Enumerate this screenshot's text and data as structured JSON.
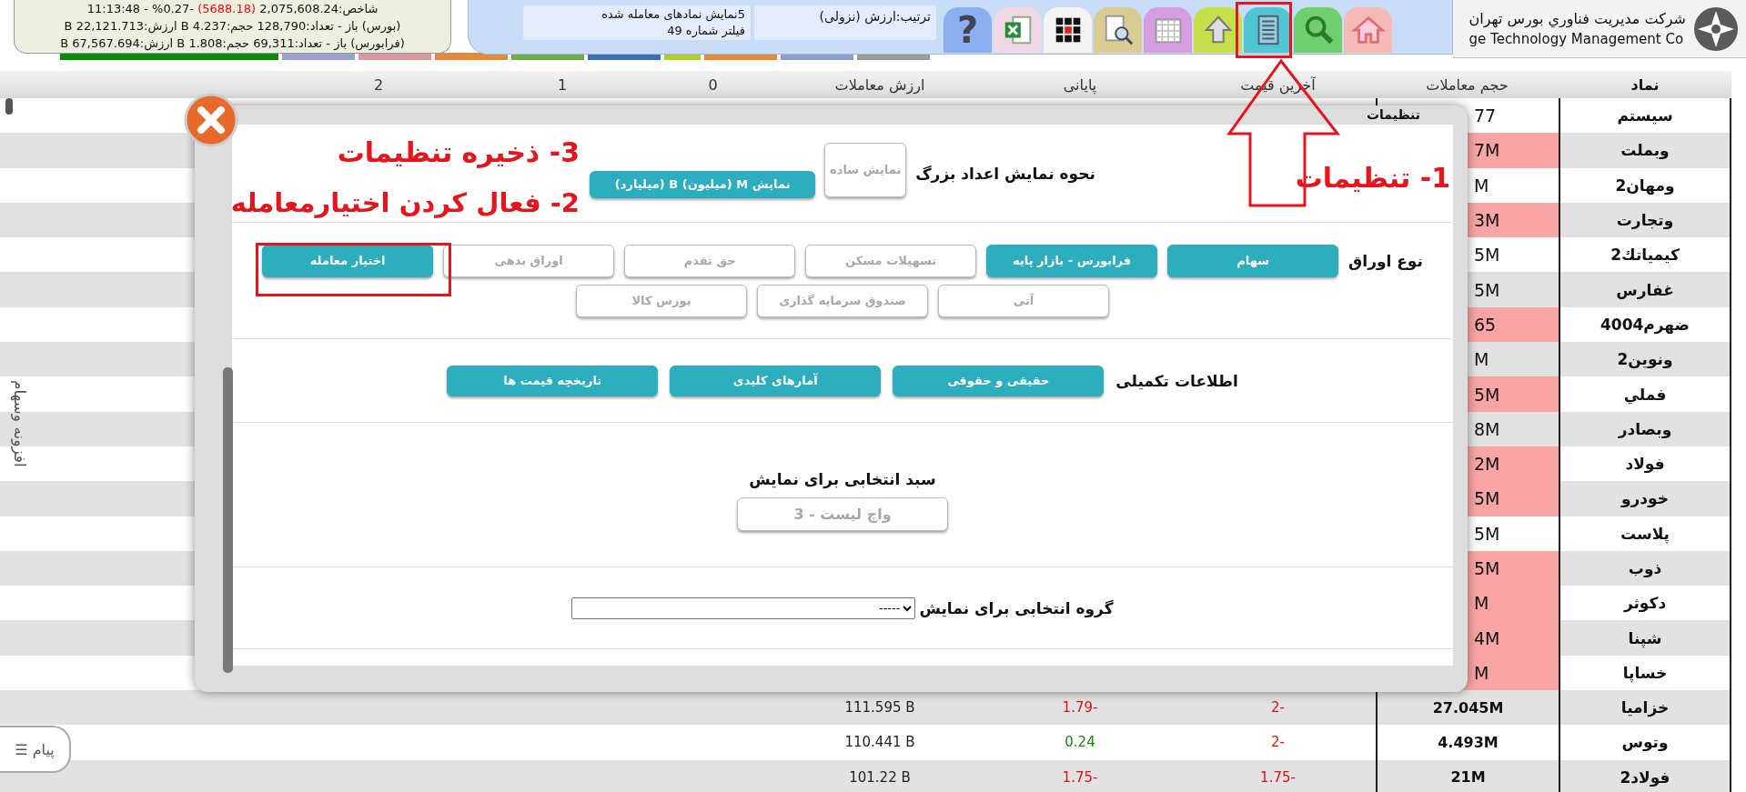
{
  "index_panel": {
    "index": {
      "before": "شاخص:2,075,608.24",
      "change": "(5688.18)",
      "after": "-0.27% - 11:13:48"
    },
    "markets": [
      "(بورس) باز - تعداد:128,790 حجم:4.237 B ارزش:22,121.713 B",
      "(فرابورس) باز - تعداد:69,311 حجم:1.808 B ارزش:67,567.694 B"
    ]
  },
  "toolbar": {
    "filter": {
      "description": "5نمایش نمادهای معامله شده",
      "number": "فیلتر شماره 49"
    },
    "sort": "ترتیب:ارزش (نزولی)",
    "tools": [
      {
        "kind": "home",
        "color": "#f7b8b8"
      },
      {
        "kind": "search",
        "color": "#6fcf6f"
      },
      {
        "kind": "list",
        "color": "#4fc6d2"
      },
      {
        "kind": "up",
        "color": "#c5e04a"
      },
      {
        "kind": "calendar",
        "color": "#d49ee0"
      },
      {
        "kind": "preview",
        "color": "#d8cc92"
      },
      {
        "kind": "grid",
        "color": "#f4f4f4"
      },
      {
        "kind": "excel",
        "color": "#f0d8e4"
      },
      {
        "kind": "help",
        "color": "#8ab0f2",
        "char": "?"
      }
    ]
  },
  "company": {
    "name": "شرکت مدیریت فناوري بورس تهران",
    "name_en": "ge Technology Management Co"
  },
  "table": {
    "columns": [
      "نماد",
      "حجم معاملات",
      "آخرین قیمت",
      "پایانی",
      "ارزش معاملات",
      "0",
      "1",
      "2"
    ],
    "rows": [
      {
        "symbol": "سیستم",
        "volume": {
          "text": "77",
          "highlight": false
        }
      },
      {
        "symbol": "وبملت",
        "volume": {
          "text": "7M",
          "highlight": true
        }
      },
      {
        "symbol": "ومهان2",
        "volume": {
          "text": "M",
          "highlight": false
        }
      },
      {
        "symbol": "وتجارت",
        "volume": {
          "text": "3M",
          "highlight": true
        }
      },
      {
        "symbol": "کیمیاتك2",
        "volume": {
          "text": "5M",
          "highlight": false
        }
      },
      {
        "symbol": "غفارس",
        "volume": {
          "text": "5M",
          "highlight": false
        }
      },
      {
        "symbol": "ضهرم4004",
        "volume": {
          "text": "65",
          "highlight": true
        }
      },
      {
        "symbol": "ونوین2",
        "volume": {
          "text": "M",
          "highlight": false
        }
      },
      {
        "symbol": "فملي",
        "volume": {
          "text": "5M",
          "highlight": true
        }
      },
      {
        "symbol": "وبصادر",
        "volume": {
          "text": "8M",
          "highlight": false
        }
      },
      {
        "symbol": "فولاد",
        "volume": {
          "text": "2M",
          "highlight": true
        }
      },
      {
        "symbol": "خودرو",
        "volume": {
          "text": "5M",
          "highlight": true
        }
      },
      {
        "symbol": "پلاست",
        "volume": {
          "text": "5M",
          "highlight": false
        }
      },
      {
        "symbol": "ذوب",
        "volume": {
          "text": "5M",
          "highlight": true
        }
      },
      {
        "symbol": "دکوثر",
        "volume": {
          "text": "M",
          "highlight": true
        }
      },
      {
        "symbol": "شپنا",
        "volume": {
          "text": "4M",
          "highlight": true
        }
      },
      {
        "symbol": "خساپا",
        "volume": {
          "text": "M",
          "highlight": true
        }
      },
      {
        "symbol": "خزامیا",
        "volume": {
          "text": "27.045M",
          "highlight": false
        },
        "last": {
          "text": "-2",
          "color": "#e01010"
        },
        "close": {
          "text": "-1.79",
          "color": "#e01010"
        },
        "value": "111.595 B"
      },
      {
        "symbol": "وتوس",
        "volume": {
          "text": "4.493M",
          "highlight": false
        },
        "last": {
          "text": "-2",
          "color": "#e01010"
        },
        "close": {
          "text": "0.24",
          "color": "#108a10"
        },
        "value": "110.441 B"
      },
      {
        "symbol": "فولاد2",
        "volume": {
          "text": "21M",
          "highlight": false
        },
        "last": {
          "text": "-1.75",
          "color": "#e01010"
        },
        "close": {
          "text": "-1.75",
          "color": "#e01010"
        },
        "value": "101.22 B"
      }
    ]
  },
  "side_tab": "افزونه وسهام",
  "message_button": {
    "label": "پیام",
    "icon": "☰"
  },
  "settings_dialog": {
    "title": "تنظیمات",
    "number_format": {
      "label": "نحوه نمایش اعداد بزرگ",
      "options": [
        {
          "label": "نمایش ساده",
          "selected": false
        },
        {
          "label": "نمایش M (میلیون) B (میلیارد)",
          "selected": true
        }
      ]
    },
    "security_types": {
      "label": "نوع اوراق",
      "options": [
        {
          "label": "سهام",
          "on": true
        },
        {
          "label": "فرابورس - بازار پایه",
          "on": true
        },
        {
          "label": "تسهیلات مسکن",
          "on": false
        },
        {
          "label": "حق تقدم",
          "on": false
        },
        {
          "label": "اوراق بدهی",
          "on": false
        },
        {
          "label": "اختیار معامله",
          "on": true
        },
        {
          "label": "آتی",
          "on": false
        },
        {
          "label": "صندوق سرمایه گذاری",
          "on": false
        },
        {
          "label": "بورس کالا",
          "on": false
        }
      ]
    },
    "extra_info": {
      "label": "اطلاعات تکمیلی",
      "options": [
        {
          "label": "حقیقی و حقوقی",
          "on": true
        },
        {
          "label": "آمارهای کلیدی",
          "on": true
        },
        {
          "label": "تاریخچه قیمت ها",
          "on": true
        }
      ]
    },
    "basket": {
      "label": "سبد انتخابی برای نمایش",
      "value": "واچ لیست - 3"
    },
    "group": {
      "label": "گروه انتخابی برای نمایش",
      "value": "-----"
    }
  },
  "annotations": {
    "step_1": "1- تنظیمات",
    "step_2": "2- فعال کردن اختیارمعامله",
    "step_3": "3- ذخیره تنظیمات"
  }
}
